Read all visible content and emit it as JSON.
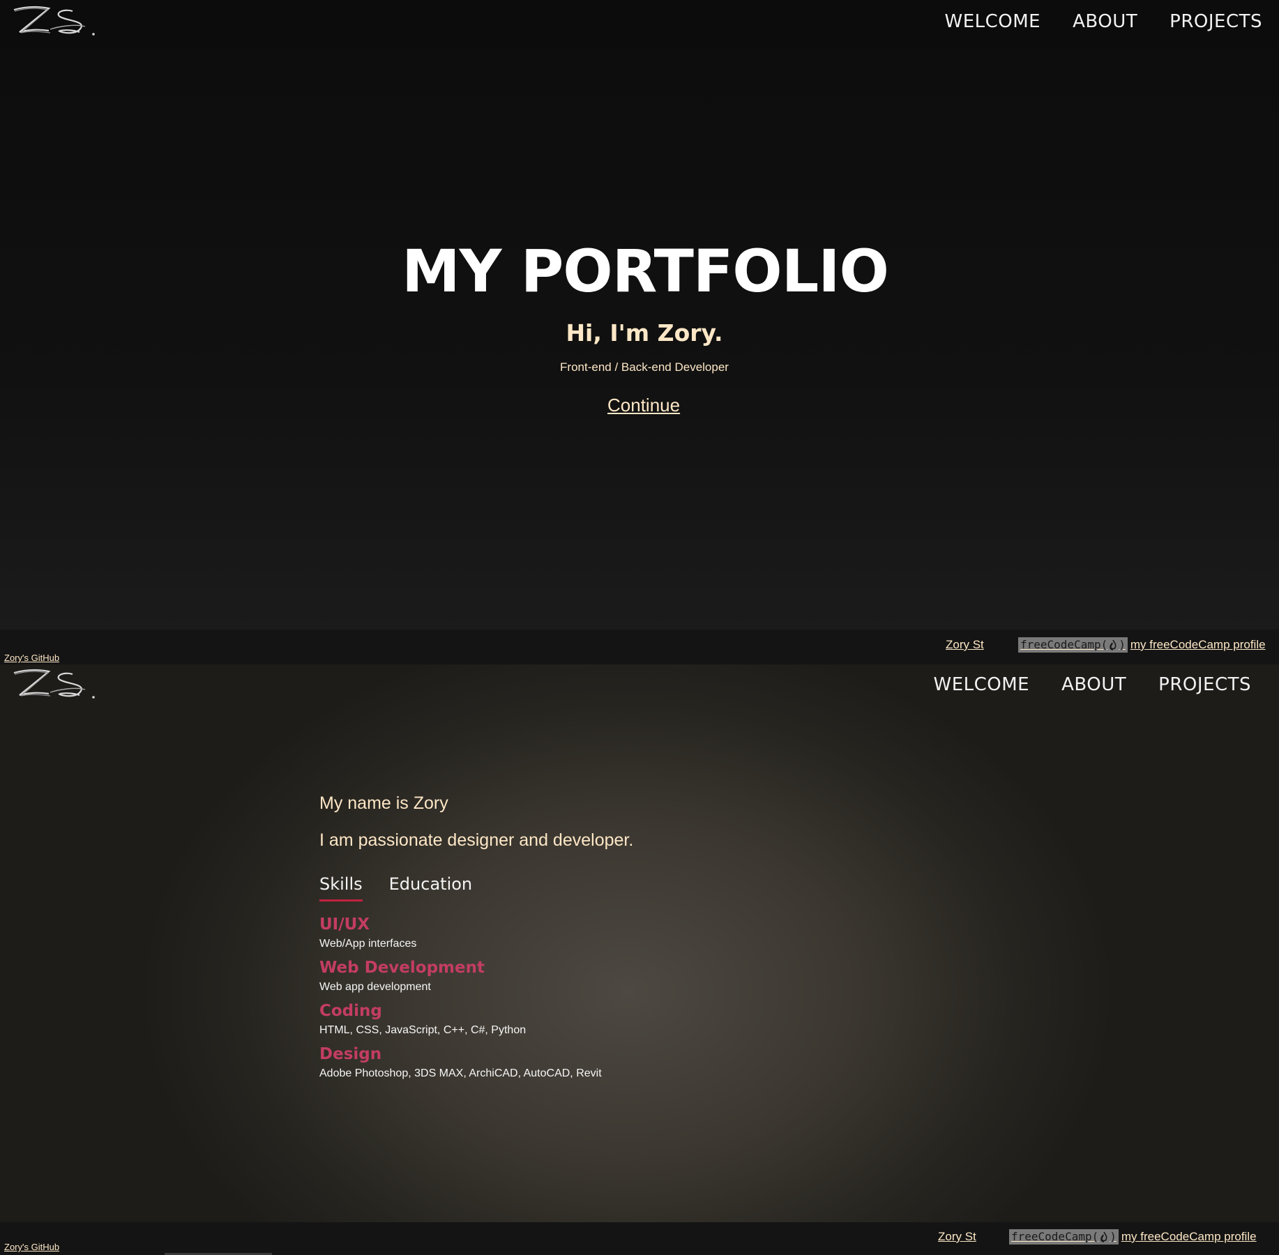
{
  "logo": {
    "alt": "Z.S."
  },
  "nav": {
    "items": [
      "WELCOME",
      "ABOUT",
      "PROJECTS"
    ]
  },
  "welcome": {
    "title": "MY PORTFOLIO",
    "greeting": "Hi, I'm Zory.",
    "role": "Front-end / Back-end Developer",
    "continue_label": "Continue"
  },
  "footer": {
    "github_label": "Zory's GitHub",
    "author_label": "Zory St",
    "fcc_badge_prefix": "freeCodeCamp(",
    "fcc_badge_suffix": ")",
    "fcc_profile_label": "my freeCodeCamp profile"
  },
  "about": {
    "name_line": "My name is Zory",
    "passion_line": "I am passionate designer and developer.",
    "tabs": [
      "Skills",
      "Education"
    ],
    "active_tab": "Skills",
    "skills": [
      {
        "title": "UI/UX",
        "desc": "Web/App interfaces"
      },
      {
        "title": "Web Development",
        "desc": "Web app development"
      },
      {
        "title": "Coding",
        "desc": "HTML, CSS, JavaScript, C++, C#, Python"
      },
      {
        "title": "Design",
        "desc": "Adobe Photoshop, 3DS MAX, ArchiCAD, AutoCAD, Revit"
      }
    ]
  },
  "colors": {
    "accent": "#c33d62",
    "tab_underline": "#c3213f",
    "cream_text": "#fde7c6",
    "dark_bg": "#0b0b0b"
  },
  "icons": [
    "logo-zs",
    "freecodecamp-flame-icon"
  ]
}
